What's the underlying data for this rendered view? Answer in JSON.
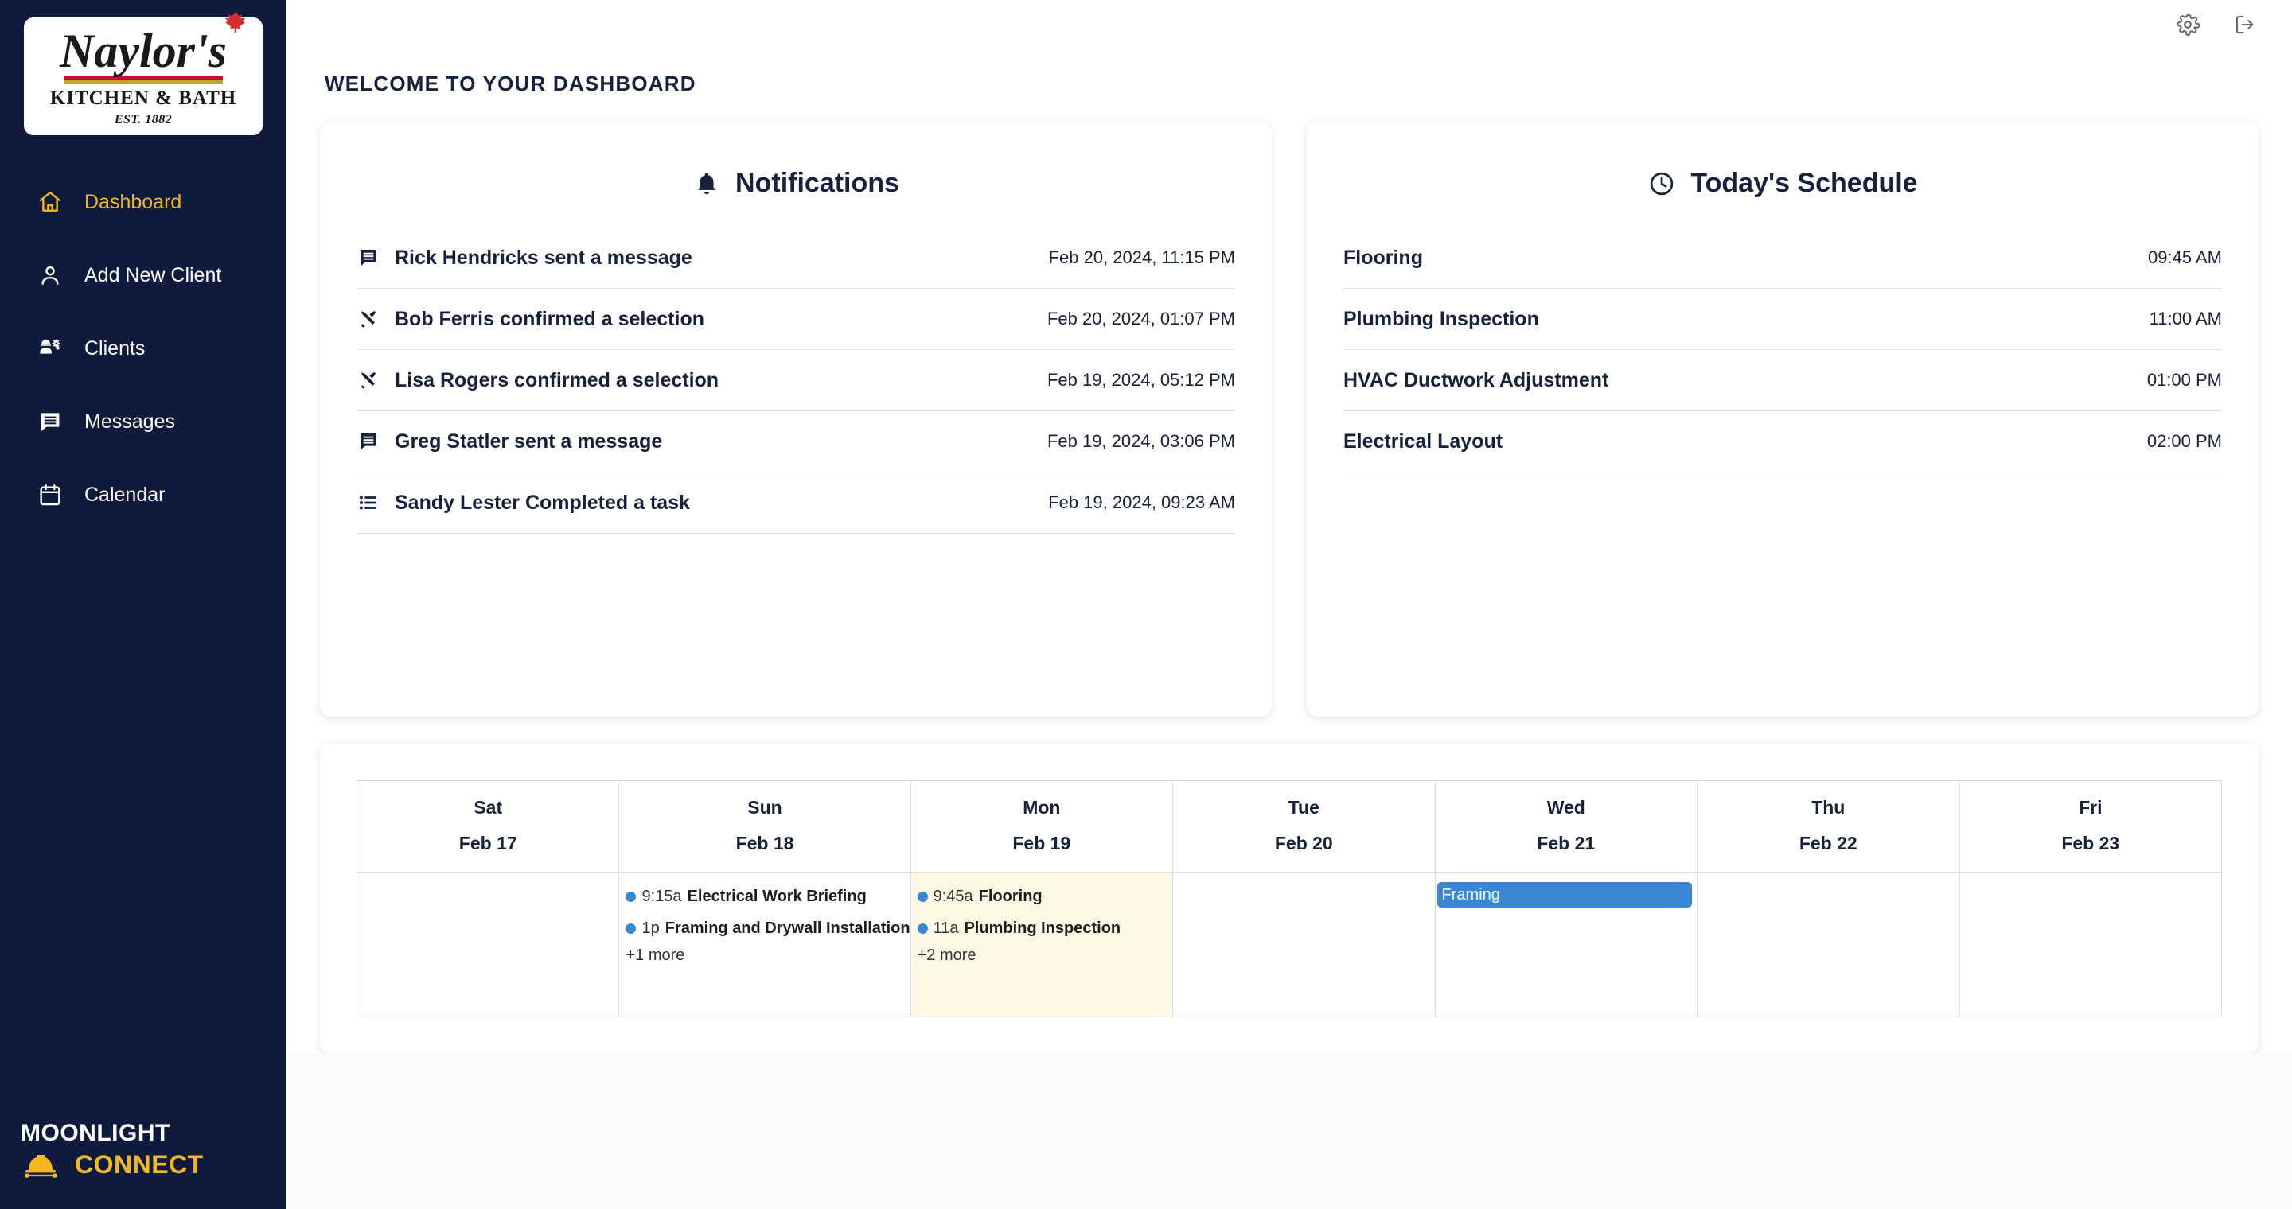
{
  "brand": {
    "logo_name": "Naylor's",
    "logo_sub": "KITCHEN & BATH",
    "logo_est": "EST. 1882",
    "footer_line1": "MOONLIGHT",
    "footer_line2": "CONNECT",
    "navy": "#0f1b3d",
    "amber": "#f5b623"
  },
  "topbar": {
    "settings_icon": "gear-icon",
    "logout_icon": "logout-icon"
  },
  "page": {
    "title": "WELCOME TO YOUR DASHBOARD"
  },
  "sidebar": {
    "items": [
      {
        "label": "Dashboard",
        "icon": "home-icon",
        "active": true
      },
      {
        "label": "Add New Client",
        "icon": "person-add-icon",
        "active": false
      },
      {
        "label": "Clients",
        "icon": "contractor-icon",
        "active": false
      },
      {
        "label": "Messages",
        "icon": "message-icon",
        "active": false
      },
      {
        "label": "Calendar",
        "icon": "calendar-icon",
        "active": false
      }
    ]
  },
  "notifications": {
    "title": "Notifications",
    "title_icon": "bell-icon",
    "items": [
      {
        "icon": "message-icon",
        "text": "Rick Hendricks sent a message",
        "time": "Feb 20, 2024, 11:15 PM"
      },
      {
        "icon": "tools-icon",
        "text": "Bob Ferris confirmed a selection",
        "time": "Feb 20, 2024, 01:07 PM"
      },
      {
        "icon": "tools-icon",
        "text": "Lisa Rogers confirmed a selection",
        "time": "Feb 19, 2024, 05:12 PM"
      },
      {
        "icon": "message-icon",
        "text": "Greg Statler sent a message",
        "time": "Feb 19, 2024, 03:06 PM"
      },
      {
        "icon": "list-icon",
        "text": "Sandy Lester Completed a task",
        "time": "Feb 19, 2024, 09:23 AM"
      }
    ]
  },
  "schedule": {
    "title": "Today's Schedule",
    "title_icon": "clock-icon",
    "items": [
      {
        "name": "Flooring",
        "time": "09:45 AM"
      },
      {
        "name": "Plumbing Inspection",
        "time": "11:00 AM"
      },
      {
        "name": "HVAC Ductwork Adjustment",
        "time": "01:00 PM"
      },
      {
        "name": "Electrical Layout",
        "time": "02:00 PM"
      }
    ]
  },
  "calendar": {
    "event_color": "#3a87d4",
    "today_bg": "#fcf8e3",
    "days": [
      {
        "dow": "Sat",
        "date": "Feb 17",
        "today": false,
        "events": [],
        "block": null,
        "more": null
      },
      {
        "dow": "Sun",
        "date": "Feb 18",
        "today": false,
        "events": [
          {
            "time": "9:15a",
            "title": "Electrical Work Briefing"
          },
          {
            "time": "1p",
            "title": "Framing and Drywall Installation"
          }
        ],
        "block": null,
        "more": "+1 more"
      },
      {
        "dow": "Mon",
        "date": "Feb 19",
        "today": true,
        "events": [
          {
            "time": "9:45a",
            "title": "Flooring"
          },
          {
            "time": "11a",
            "title": "Plumbing Inspection"
          }
        ],
        "block": null,
        "more": "+2 more"
      },
      {
        "dow": "Tue",
        "date": "Feb 20",
        "today": false,
        "events": [],
        "block": null,
        "more": null
      },
      {
        "dow": "Wed",
        "date": "Feb 21",
        "today": false,
        "events": [],
        "block": "Framing",
        "more": null
      },
      {
        "dow": "Thu",
        "date": "Feb 22",
        "today": false,
        "events": [],
        "block": null,
        "more": null
      },
      {
        "dow": "Fri",
        "date": "Feb 23",
        "today": false,
        "events": [],
        "block": null,
        "more": null
      }
    ]
  }
}
